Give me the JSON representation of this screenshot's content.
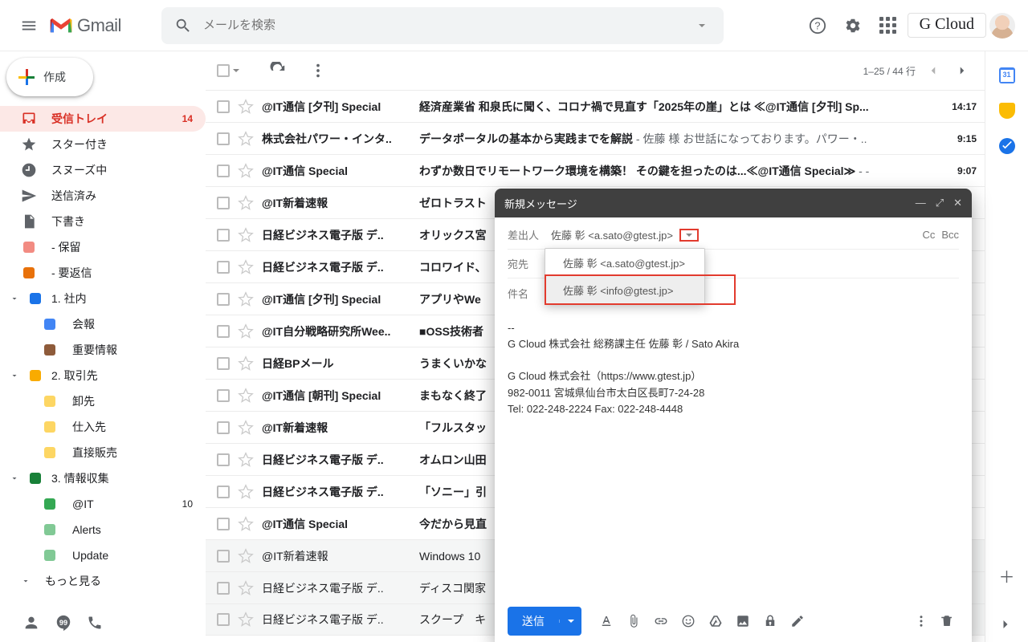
{
  "header": {
    "logo_text": "Gmail",
    "search_placeholder": "メールを検索",
    "brand": "G Cloud"
  },
  "sidebar": {
    "compose": "作成",
    "items": [
      {
        "icon": "inbox",
        "label": "受信トレイ",
        "count": "14",
        "active": true
      },
      {
        "icon": "star",
        "label": "スター付き"
      },
      {
        "icon": "snooze",
        "label": "スヌーズ中"
      },
      {
        "icon": "sent",
        "label": "送信済み"
      },
      {
        "icon": "draft",
        "label": "下書き"
      },
      {
        "icon": "label",
        "label": "- 保留",
        "color": "#f28b82"
      },
      {
        "icon": "label",
        "label": "- 要返信",
        "color": "#e8710a"
      }
    ],
    "sections": [
      {
        "label": "1. 社内",
        "color": "#1a73e8",
        "children": [
          {
            "label": "会報",
            "color": "#4285f4"
          },
          {
            "label": "重要情報",
            "color": "#8e5b3a"
          }
        ]
      },
      {
        "label": "2. 取引先",
        "color": "#f9ab00",
        "children": [
          {
            "label": "卸先",
            "color": "#fdd663"
          },
          {
            "label": "仕入先",
            "color": "#fdd663"
          },
          {
            "label": "直接販売",
            "color": "#fdd663"
          }
        ]
      },
      {
        "label": "3. 情報収集",
        "color": "#188038",
        "children": [
          {
            "label": "@IT",
            "count": "10",
            "color": "#34a853"
          },
          {
            "label": "Alerts",
            "color": "#81c995"
          },
          {
            "label": "Update",
            "color": "#81c995"
          }
        ]
      }
    ],
    "more": "もっと見る"
  },
  "toolbar": {
    "range": "1–25 / 44 行"
  },
  "emails": [
    {
      "sender": "@IT通信 [夕刊] Special",
      "subject": "経済産業省 和泉氏に聞く、コロナ禍で見直す「2025年の崖」とは ≪@IT通信 [夕刊] Sp...",
      "time": "14:17"
    },
    {
      "sender": "株式会社パワー・インタ..",
      "subject": "データポータルの基本から実践までを解説",
      "snippet": " - 佐藤 様 お世話になっております。パワー・..",
      "time": "9:15"
    },
    {
      "sender": "@IT通信 Special",
      "subject": "わずか数日でリモートワーク環境を構築！ その鍵を担ったのは...≪@IT通信 Special≫",
      "snippet": " - -",
      "time": "9:07"
    },
    {
      "sender": "@IT新着速報",
      "subject": "ゼロトラスト",
      "time": ""
    },
    {
      "sender": "日経ビジネス電子版 デ..",
      "subject": "オリックス宮",
      "time": ""
    },
    {
      "sender": "日経ビジネス電子版 デ..",
      "subject": "コロワイド、",
      "time": ""
    },
    {
      "sender": "@IT通信 [夕刊] Special",
      "subject": "アプリやWe",
      "time": ""
    },
    {
      "sender": "@IT自分戦略研究所Wee..",
      "subject": "■OSS技術者",
      "time": ""
    },
    {
      "sender": "日経BPメール",
      "subject": "うまくいかな",
      "time": ""
    },
    {
      "sender": "@IT通信 [朝刊] Special",
      "subject": "まもなく終了",
      "time": ""
    },
    {
      "sender": "@IT新着速報",
      "subject": "「フルスタッ",
      "time": ""
    },
    {
      "sender": "日経ビジネス電子版 デ..",
      "subject": "オムロン山田",
      "time": ""
    },
    {
      "sender": "日経ビジネス電子版 デ..",
      "subject": "「ソニー」引",
      "time": ""
    },
    {
      "sender": "@IT通信 Special",
      "subject": "今だから見直",
      "time": ""
    },
    {
      "sender": "@IT新着速報",
      "subject": "Windows 10",
      "time": "",
      "read": true
    },
    {
      "sender": "日経ビジネス電子版 デ..",
      "subject": "ディスコ関家",
      "time": "",
      "read": true
    },
    {
      "sender": "日経ビジネス電子版 デ..",
      "subject": "スクープ　キ",
      "time": "",
      "read": true
    }
  ],
  "compose": {
    "title": "新規メッセージ",
    "from_label": "差出人",
    "to_label": "宛先",
    "subject_label": "件名",
    "cc": "Cc",
    "bcc": "Bcc",
    "from_value": "佐藤 彰 <a.sato@gtest.jp>",
    "from_options": [
      "佐藤 彰 <a.sato@gtest.jp>",
      "佐藤 彰 <info@gtest.jp>"
    ],
    "signature": "--\nG Cloud 株式会社  総務課主任  佐藤 彰 / Sato Akira\n\nG Cloud 株式会社（https://www.gtest.jp）\n982-0011 宮城県仙台市太白区長町7-24-28\nTel: 022-248-2224    Fax: 022-248-4448",
    "send": "送信"
  }
}
